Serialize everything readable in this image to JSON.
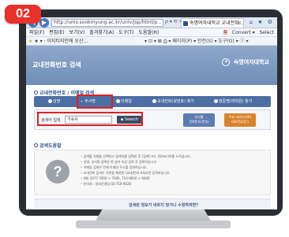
{
  "badge": "02",
  "browser": {
    "url": "http://univ.sookmyung.ac.kr/univ/jsp/html/p...",
    "url_controls": "ρ ▾ ⟲ ✕",
    "tab_title": "숙명여자대학교 교내전화...",
    "tab_close": "✕",
    "chrome_icons": "⌂ ★ ⚙",
    "menu": [
      "파일(F)",
      "편집(E)",
      "보기(V)",
      "즐겨찾기(A)",
      "도구(T)",
      "도움말(H)"
    ],
    "convert_label": "Convert",
    "convert_extra": "Select",
    "favorites_text": "★ ▾ · 이지티지인에 오신...",
    "fav_tools": "▾ ⊡ ▾ ⊠ ⎙ ▾ 페이지(P) ▾ 안전(S) ▾ 도구(O) ▾ ⓘ ▾"
  },
  "page": {
    "title": "교내전화번호 검색",
    "logo": "숙명여자대학교",
    "logo_emblem": "✦",
    "search_section_title": "교내전화번호 / 이메일 검색",
    "radio_options": [
      "성명",
      "부서명",
      "이메일",
      "교내전화(뒷번호) 찾기",
      "영문명(여직원) 찾기"
    ],
    "selected_radio": "부서명",
    "search_label": "검색어 입력",
    "search_value": "기숙사",
    "search_button": "Search",
    "service_a": "부서별\n전화번호(번호)",
    "service_b": "주요 서비스(UX)\n대표번호찾기",
    "guide_title": "검색도움말",
    "guide_items": [
      "검색할 유형을 선택하고 검색어를 입력한 후 [검색] 또는 [Enter]키를 누르십시오.",
      "성명, 부서명 검색은 한 글자 이상 입력 후 검색하십시오.",
      "이메일 검색은 전체 이메일 주소를 입력하십시오.",
      "교내전화 검색은 국번을 제외한 (교내)번호 4자리만 입력하십시오.",
      "(예) 2077-7000 > 7000, 710-9000 > 9000",
      "문의처 : 정보운영팀 02-710-9026"
    ],
    "footer_text": "검색된 정보가 바르지 않거나 수정하려면?"
  }
}
